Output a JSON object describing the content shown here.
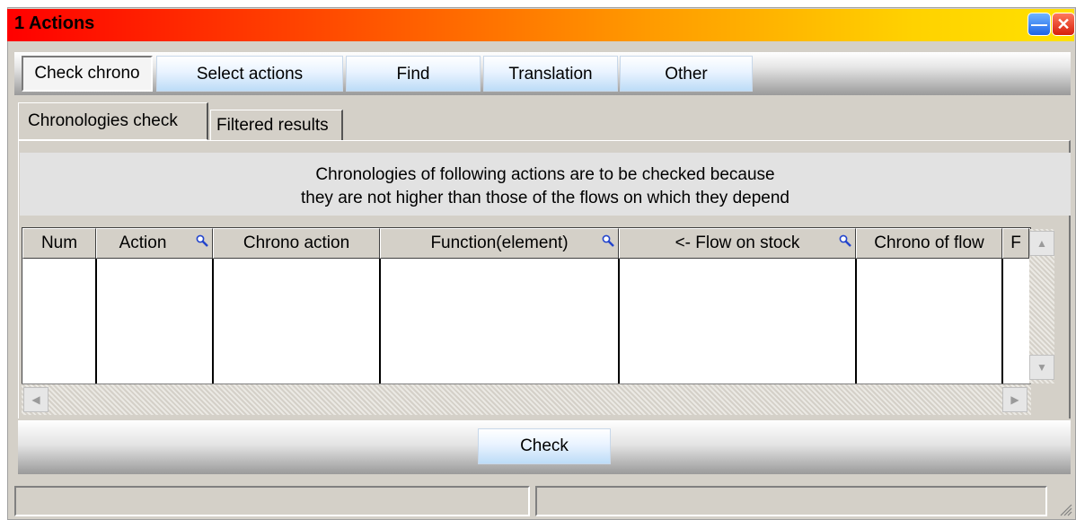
{
  "window": {
    "title": "1  Actions"
  },
  "menu": [
    {
      "label": "Check chrono",
      "active": true
    },
    {
      "label": "Select actions"
    },
    {
      "label": "Find"
    },
    {
      "label": "Translation"
    },
    {
      "label": "Other"
    }
  ],
  "tabs": [
    {
      "label": "Chronologies check",
      "active": true
    },
    {
      "label": "Filtered results"
    }
  ],
  "info": {
    "line1": "Chronologies of following actions are to be checked because",
    "line2": "they are not higher than those of the flows on which they depend"
  },
  "table": {
    "columns": [
      {
        "label": "Num"
      },
      {
        "label": "Action",
        "icon": "search-icon"
      },
      {
        "label": "Chrono action"
      },
      {
        "label": "Function(element)",
        "icon": "search-icon"
      },
      {
        "label": "<- Flow on stock",
        "icon": "search-icon"
      },
      {
        "label": "Chrono of flow"
      },
      {
        "label": "F"
      }
    ],
    "rows": []
  },
  "footer": {
    "check_label": "Check"
  },
  "colors": {
    "title_start": "#ff0000",
    "title_end": "#ffe100",
    "face": "#d4d0c8"
  }
}
